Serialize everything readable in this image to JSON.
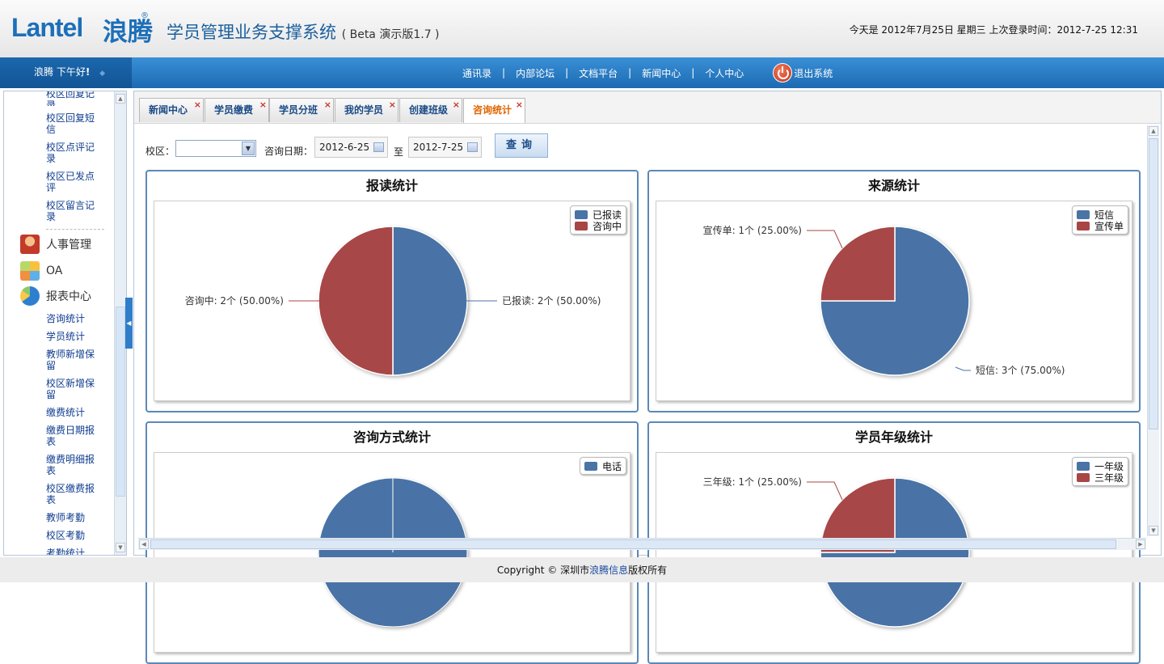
{
  "header": {
    "logo_en": "Lantel",
    "logo_cn": "浪腾",
    "logo_reg": "®",
    "title": "学员管理业务支撑系统",
    "version": "( Beta 演示版1.7 )",
    "date_text": "今天是  2012年7月25日  星期三   上次登录时间：2012-7-25 12:31"
  },
  "nav": {
    "greeting": "浪腾  下午好",
    "greeting_mark": "!",
    "links": [
      "通讯录",
      "内部论坛",
      "文档平台",
      "新闻中心",
      "个人中心"
    ],
    "separator": "|",
    "logout": "退出系统"
  },
  "sidebar": {
    "top_items": [
      "校区回复记录",
      "校区回复短信",
      "校区点评记录",
      "校区已发点评",
      "校区留言记录"
    ],
    "groups": [
      {
        "label": "人事管理",
        "icon": "user-icon"
      },
      {
        "label": "OA",
        "icon": "oa-icon"
      },
      {
        "label": "报表中心",
        "icon": "report-chart-icon"
      }
    ],
    "report_items": [
      "咨询统计",
      "学员统计",
      "教师新增保留",
      "校区新增保留",
      "缴费统计",
      "缴费日期报表",
      "缴费明细报表",
      "校区缴费报表",
      "教师考勤",
      "校区考勤",
      "考勤统计"
    ]
  },
  "tabs": [
    {
      "label": "新闻中心",
      "close": "×"
    },
    {
      "label": "学员缴费",
      "close": "×"
    },
    {
      "label": "学员分班",
      "close": "×"
    },
    {
      "label": "我的学员",
      "close": "×"
    },
    {
      "label": "创建班级",
      "close": "×"
    },
    {
      "label": "咨询统计",
      "close": "×",
      "active": true
    }
  ],
  "filter": {
    "campus_label": "校区：",
    "campus_value": "",
    "date_label": "咨询日期：",
    "date_from": "2012-6-25",
    "to_label": "至",
    "date_to": "2012-7-25",
    "query_button": "查询"
  },
  "colors": {
    "blue": "#4a73a6",
    "red": "#a84646",
    "accent": "#1c6bb2",
    "active_tab": "#e06600"
  },
  "chart_data": [
    {
      "type": "pie",
      "title": "报读统计",
      "categories": [
        "已报读",
        "咨询中"
      ],
      "values": [
        2,
        2
      ],
      "percents": [
        "50.00%",
        "50.00%"
      ],
      "labels": [
        "已报读: 2个 (50.00%)",
        "咨询中: 2个 (50.00%)"
      ],
      "legend": [
        "已报读",
        "咨询中"
      ],
      "legend_position": "top-right"
    },
    {
      "type": "pie",
      "title": "来源统计",
      "categories": [
        "短信",
        "宣传单"
      ],
      "values": [
        3,
        1
      ],
      "percents": [
        "75.00%",
        "25.00%"
      ],
      "labels": [
        "短信: 3个 (75.00%)",
        "宣传单: 1个 (25.00%)"
      ],
      "legend": [
        "短信",
        "宣传单"
      ],
      "legend_position": "top-right"
    },
    {
      "type": "pie",
      "title": "咨询方式统计",
      "categories": [
        "电话"
      ],
      "values": [
        1
      ],
      "percents": [
        "100.00%"
      ],
      "labels": [
        ""
      ],
      "legend": [
        "电话"
      ],
      "legend_position": "top-right"
    },
    {
      "type": "pie",
      "title": "学员年级统计",
      "categories": [
        "一年级",
        "三年级"
      ],
      "values": [
        3,
        1
      ],
      "percents": [
        "75.00%",
        "25.00%"
      ],
      "labels": [
        "",
        "三年级: 1个 (25.00%)"
      ],
      "legend": [
        "一年级",
        "三年级"
      ],
      "legend_position": "top-right"
    }
  ],
  "footer": {
    "prefix": "Copyright © 深圳市",
    "link": "浪腾信息",
    "suffix": "版权所有"
  }
}
